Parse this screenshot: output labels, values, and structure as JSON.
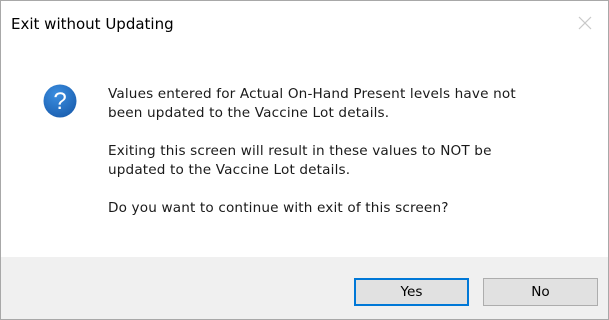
{
  "window": {
    "title": "Exit without Updating",
    "close_icon": "close-icon"
  },
  "dialog": {
    "icon": "question-icon",
    "icon_color": "#1f6fbf",
    "messages": [
      "Values entered for Actual On-Hand Present levels have not\nbeen updated to the Vaccine Lot details.",
      "Exiting this screen will result in these values to NOT be\nupdated to the Vaccine Lot details.",
      "Do you want to continue with exit of this screen?"
    ]
  },
  "buttons": {
    "yes_label": "Yes",
    "no_label": "No",
    "default_focus_color": "#0078d7"
  }
}
